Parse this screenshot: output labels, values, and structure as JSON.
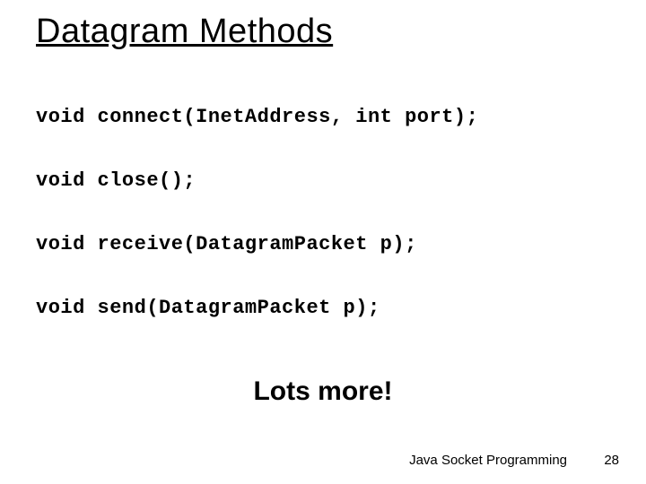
{
  "title": "Datagram Methods",
  "methods": [
    "void connect(InetAddress, int port);",
    "void close();",
    "void receive(DatagramPacket p);",
    "void send(DatagramPacket p);"
  ],
  "lots_more": "Lots more!",
  "footer": "Java Socket Programming",
  "page_number": "28"
}
